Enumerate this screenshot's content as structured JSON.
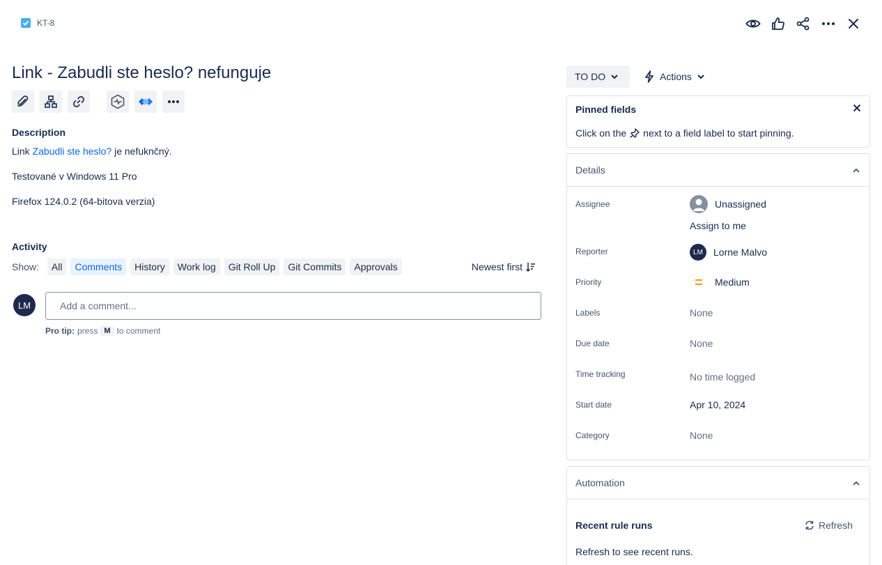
{
  "header": {
    "issue_key": "KT-8",
    "title": "Link - Zabudli ste heslo? nefunguje"
  },
  "description": {
    "label": "Description",
    "line1_prefix": "Link ",
    "line1_link": "Zabudli ste heslo?",
    "line1_suffix": " je nefuknčný.",
    "line2": "Testované v Windows 11 Pro",
    "line3": "Firefox 124.0.2 (64-bitova verzia)"
  },
  "activity": {
    "label": "Activity",
    "show_label": "Show:",
    "filters": [
      "All",
      "Comments",
      "History",
      "Work log",
      "Git Roll Up",
      "Git Commits",
      "Approvals"
    ],
    "active_filter": "Comments",
    "sort_label": "Newest first",
    "avatar_initials": "LM",
    "comment_placeholder": "Add a comment...",
    "pro_tip_label": "Pro tip:",
    "pro_tip_press": "press",
    "pro_tip_key": "M",
    "pro_tip_suffix": "to comment"
  },
  "status": {
    "label": "TO DO",
    "actions_label": "Actions"
  },
  "pinned": {
    "title": "Pinned fields",
    "text_before": "Click on the",
    "text_after": "next to a field label to start pinning."
  },
  "details": {
    "title": "Details",
    "assignee_label": "Assignee",
    "assignee_value": "Unassigned",
    "assign_to_me": "Assign to me",
    "reporter_label": "Reporter",
    "reporter_initials": "LM",
    "reporter_value": "Lorne Malvo",
    "priority_label": "Priority",
    "priority_value": "Medium",
    "labels_label": "Labels",
    "labels_value": "None",
    "due_date_label": "Due date",
    "due_date_value": "None",
    "time_tracking_label": "Time tracking",
    "time_tracking_value": "No time logged",
    "start_date_label": "Start date",
    "start_date_value": "Apr 10, 2024",
    "category_label": "Category",
    "category_value": "None"
  },
  "automation": {
    "title": "Automation",
    "recent_rule_runs": "Recent rule runs",
    "refresh_label": "Refresh",
    "refresh_text": "Refresh to see recent runs."
  },
  "colors": {
    "accent": "#0c66e4",
    "priority_medium": "#f79a1f",
    "task_icon": "#4bade8"
  }
}
